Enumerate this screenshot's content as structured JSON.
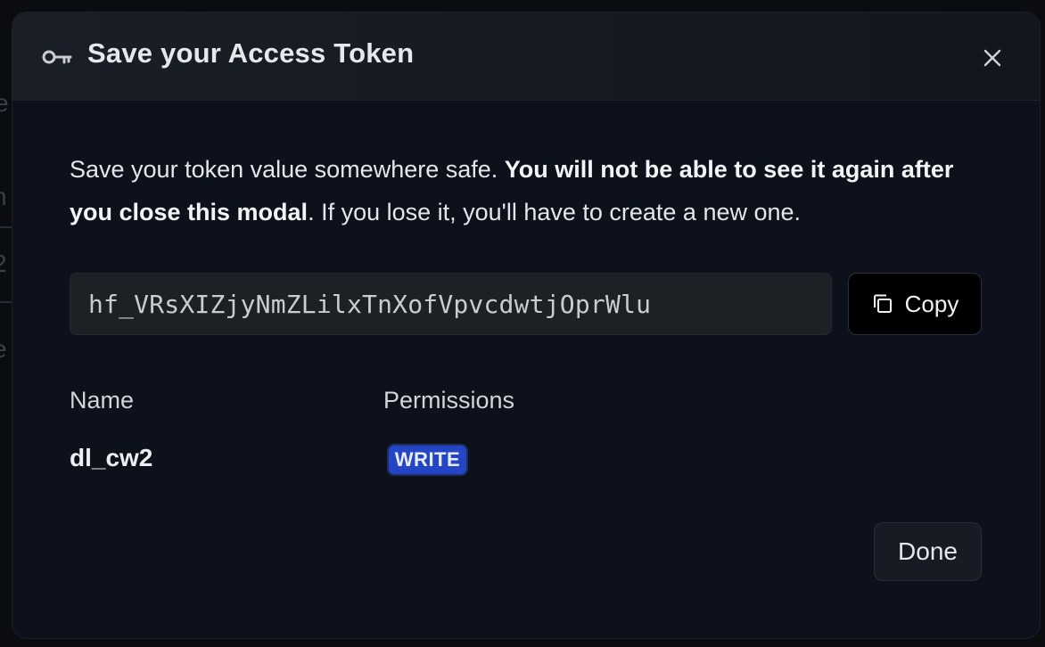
{
  "modal": {
    "title": "Save your Access Token",
    "intro": {
      "part1": "Save your token value somewhere safe. ",
      "bold": "You will not be able to see it again after you close this modal",
      "part2": ". If you lose it, you'll have to create a new one."
    },
    "token_value": "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",
    "copy_label": "Copy",
    "table": {
      "name_header": "Name",
      "permissions_header": "Permissions",
      "name_value": "dl_cw2",
      "permission_value": "WRITE"
    },
    "done_label": "Done"
  },
  "icons": {
    "title_icon": "key-icon",
    "close_icon": "close-icon",
    "copy_icon": "copy-icon"
  },
  "colors": {
    "badge_bg": "#2446c4",
    "modal_bg": "#0c111b",
    "copy_bg": "#000000"
  }
}
